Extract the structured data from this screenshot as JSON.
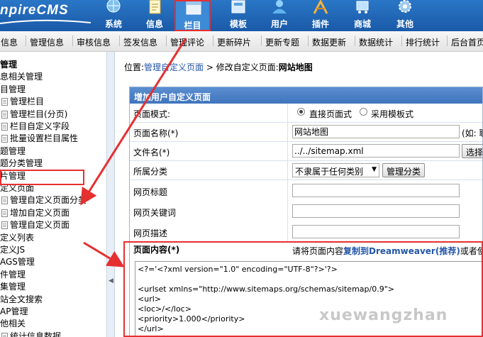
{
  "header": {
    "logo": "npireCMS",
    "nav": [
      {
        "label": "系统",
        "icon": "globe-icon"
      },
      {
        "label": "信息",
        "icon": "notepad-icon"
      },
      {
        "label": "栏目",
        "icon": "window-icon",
        "active": true
      },
      {
        "label": "模板",
        "icon": "template-icon"
      },
      {
        "label": "用户",
        "icon": "user-icon"
      },
      {
        "label": "插件",
        "icon": "plugin-icon"
      },
      {
        "label": "商城",
        "icon": "shop-icon"
      },
      {
        "label": "其他",
        "icon": "gear-icon"
      }
    ]
  },
  "submenu": [
    "信息",
    "管理信息",
    "审核信息",
    "签发信息",
    "管理评论",
    "更新碎片",
    "更新专题",
    "数据更新",
    "数据统计",
    "排行统计",
    "后台首页"
  ],
  "tree": [
    {
      "label": "管理",
      "bold": true,
      "icon": false
    },
    {
      "label": "息相关管理",
      "icon": false
    },
    {
      "label": "目管理",
      "icon": false
    },
    {
      "label": "管理栏目",
      "icon": true
    },
    {
      "label": "管理栏目(分页)",
      "icon": true
    },
    {
      "label": "栏目自定义字段",
      "icon": true
    },
    {
      "label": "批量设置栏目属性",
      "icon": true
    },
    {
      "label": "题管理",
      "icon": false
    },
    {
      "label": "题分类管理",
      "icon": false
    },
    {
      "label": "片管理",
      "icon": false
    },
    {
      "label": "定义页面",
      "icon": false
    },
    {
      "label": "管理自定义页面分类",
      "icon": true
    },
    {
      "label": "增加自定义页面",
      "icon": true
    },
    {
      "label": "管理自定义页面",
      "icon": true
    },
    {
      "label": "定义列表",
      "icon": false
    },
    {
      "label": "定义JS",
      "icon": false
    },
    {
      "label": "AGS管理",
      "icon": false
    },
    {
      "label": "件管理",
      "icon": false
    },
    {
      "label": "集管理",
      "icon": false
    },
    {
      "label": "站全文搜索",
      "icon": false
    },
    {
      "label": "AP管理",
      "icon": false
    },
    {
      "label": "他相关",
      "icon": false
    },
    {
      "label": "统计信息数据",
      "icon": true
    }
  ],
  "breadcrumb": {
    "prefix": "位置:",
    "link": "管理自定义页面",
    "sep": " > ",
    "middle": "修改自定义页面:",
    "current": "网站地图"
  },
  "form": {
    "title": "增加用户自定义页面",
    "mode_label": "页面模式:",
    "mode_opt1": "直接页面式",
    "mode_opt2": "采用模板式",
    "name_label": "页面名称(*)",
    "name_value": "网站地图",
    "name_hint": "(如: 联",
    "file_label": "文件名(*)",
    "file_value": "../../sitemap.xml",
    "file_btn": "选择",
    "cat_label": "所属分类",
    "cat_value": "不隶属于任何类别",
    "cat_btn": "管理分类",
    "title_label": "网页标题",
    "keywords_label": "网页关键词",
    "desc_label": "网页描述",
    "content_label": "页面内容(*)",
    "content_tip_pre": "请将页面内容",
    "content_tip_link": "复制到Dreamweaver(推荐)",
    "content_tip_post": "或者使用",
    "content_code": "<?='<?xml version=\"1.0\" encoding=\"UTF-8\"?>'?>\n\n<urlset xmlns=\"http://www.sitemaps.org/schemas/sitemap/0.9\">\n<url>\n<loc>/</loc>\n<priority>1.000</priority>\n</url>"
  },
  "watermark": "xuewangzhan",
  "colors": {
    "highlight": "#e53030",
    "header": "#2a76c6",
    "panel_head": "#4a80c6",
    "link": "#2456a8"
  }
}
